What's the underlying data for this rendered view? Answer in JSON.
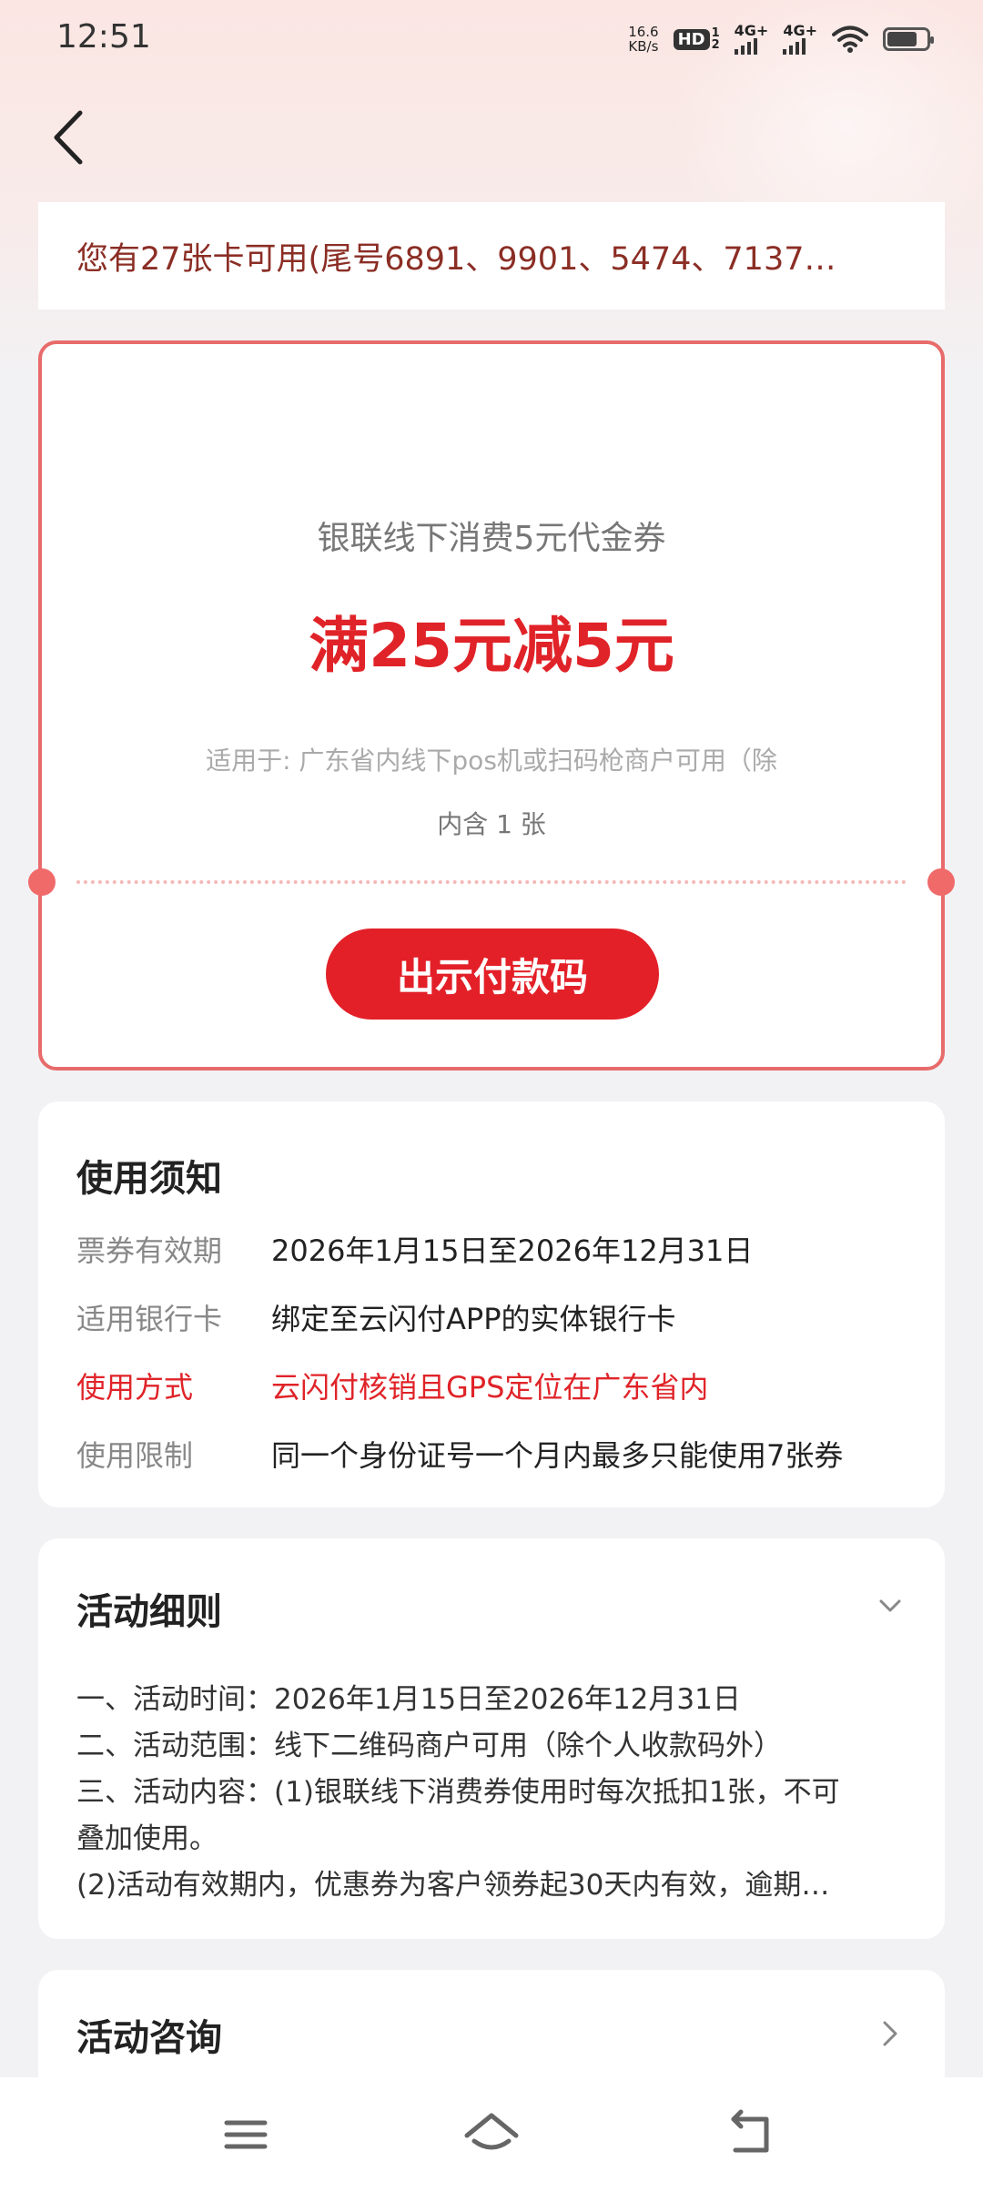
{
  "status_bar": {
    "time": "12:51",
    "net_speed_value": "16.6",
    "net_speed_unit": "KB/s",
    "hd_label": "HD",
    "sim1": "4G+",
    "sim2": "4G+",
    "hd_sub": "2",
    "hd_sup": "1"
  },
  "card_notice": "您有27张卡可用(尾号6891、9901、5474、7137…",
  "coupon": {
    "title": "银联线下消费5元代金券",
    "amount": "满25元减5元",
    "scope": "适用于: 广东省内线下pos机或扫码枪商户可用（除",
    "quantity": "内含 1 张",
    "button_label": "出示付款码",
    "accent_color": "#e02328"
  },
  "usage": {
    "heading": "使用须知",
    "rows": [
      {
        "key": "票券有效期",
        "value": "2026年1月15日至2026年12月31日"
      },
      {
        "key": "适用银行卡",
        "value": "绑定至云闪付APP的实体银行卡"
      },
      {
        "key": "使用方式",
        "value": "云闪付核销且GPS定位在广东省内"
      },
      {
        "key": "使用限制",
        "value": "同一个身份证号一个月内最多只能使用7张券"
      }
    ]
  },
  "rules": {
    "heading": "活动细则",
    "lines": [
      "一、活动时间：2026年1月15日至2026年12月31日",
      "二、活动范围：线下二维码商户可用（除个人收款码外）",
      "三、活动内容：(1)银联线下消费券使用时每次抵扣1张，不可",
      "叠加使用。",
      "(2)活动有效期内，优惠券为客户领券起30天内有效，逾期…"
    ]
  },
  "consult": {
    "heading": "活动咨询"
  }
}
